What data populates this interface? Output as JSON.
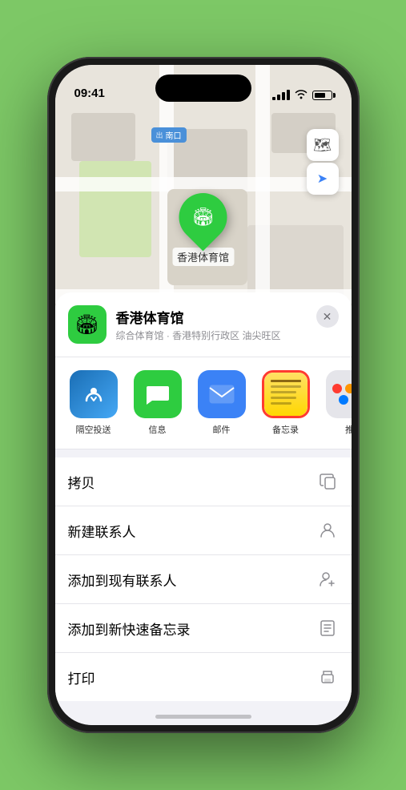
{
  "status": {
    "time": "09:41",
    "location_arrow": "▶"
  },
  "map": {
    "label": "南口",
    "label_prefix": "出"
  },
  "location": {
    "name": "香港体育馆",
    "subtitle": "综合体育馆 · 香港特别行政区 油尖旺区",
    "icon": "🏟"
  },
  "share": {
    "items": [
      {
        "id": "airdrop",
        "label": "隔空投送"
      },
      {
        "id": "messages",
        "label": "信息"
      },
      {
        "id": "mail",
        "label": "邮件"
      },
      {
        "id": "notes",
        "label": "备忘录"
      },
      {
        "id": "more",
        "label": "推"
      }
    ]
  },
  "actions": [
    {
      "label": "拷贝",
      "icon": "copy"
    },
    {
      "label": "新建联系人",
      "icon": "person"
    },
    {
      "label": "添加到现有联系人",
      "icon": "person-add"
    },
    {
      "label": "添加到新快速备忘录",
      "icon": "note"
    },
    {
      "label": "打印",
      "icon": "print"
    }
  ],
  "buttons": {
    "close": "✕",
    "map_view": "🗺",
    "location": "➤"
  }
}
